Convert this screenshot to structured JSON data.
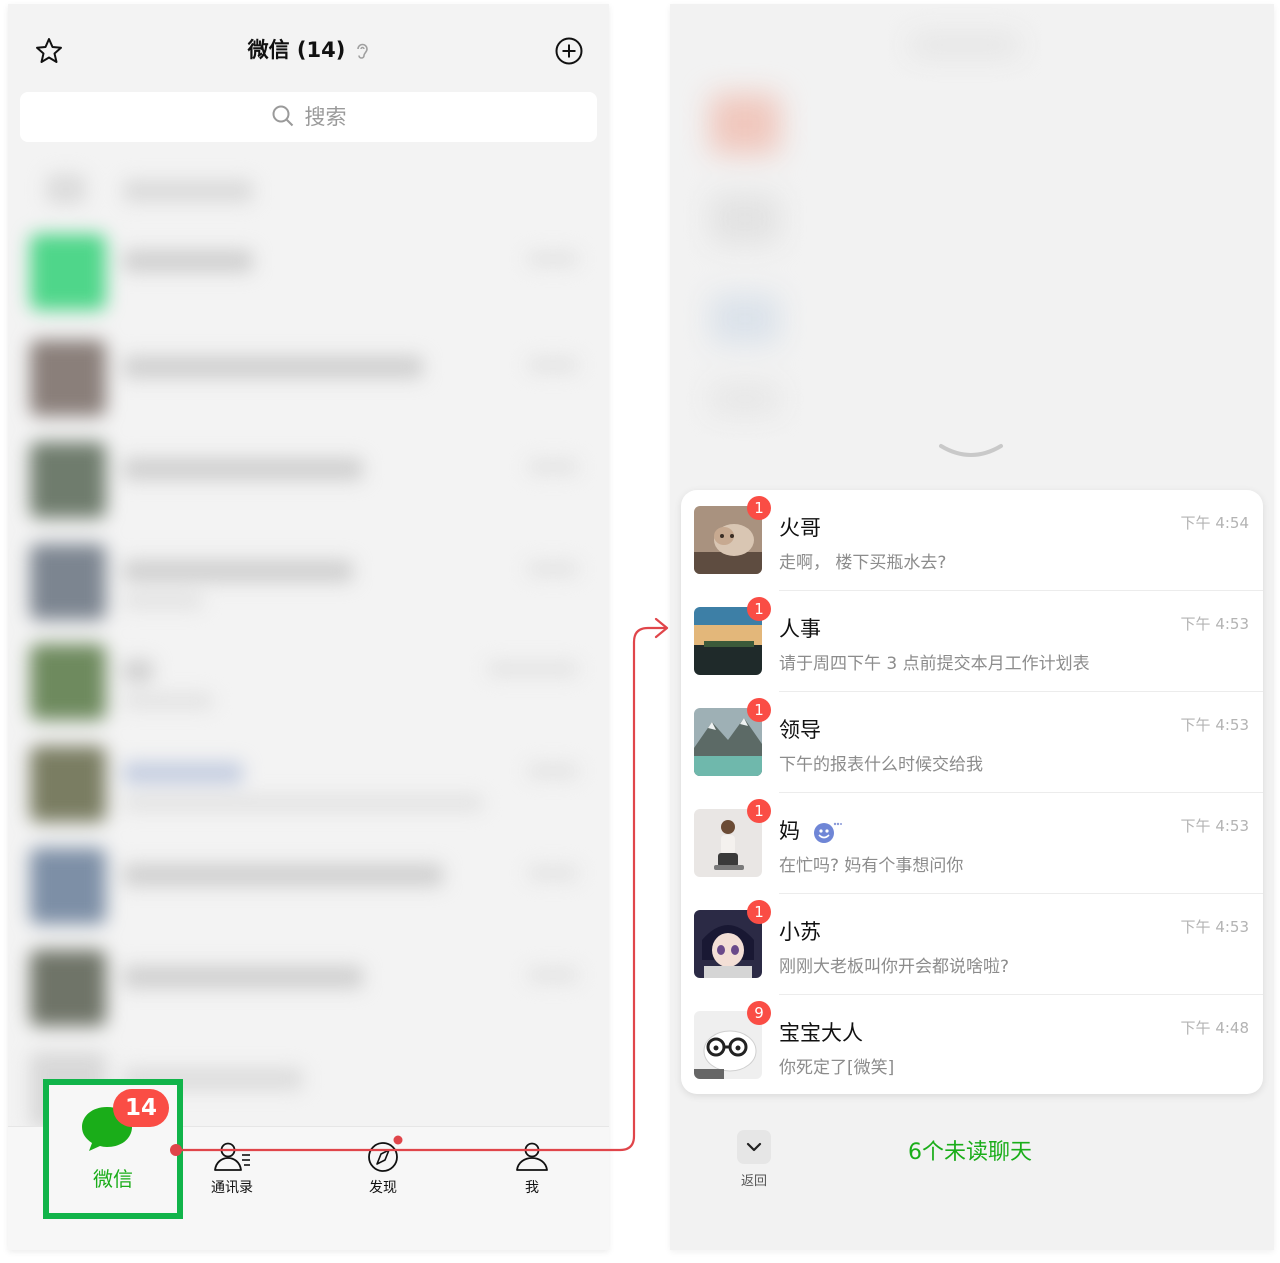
{
  "left": {
    "header": {
      "title": "微信 (14)"
    },
    "search": {
      "placeholder": "搜索"
    },
    "tabs": [
      {
        "label": "微信",
        "badge": "14"
      },
      {
        "label": "通讯录"
      },
      {
        "label": "发现"
      },
      {
        "label": "我"
      }
    ]
  },
  "right": {
    "chats": [
      {
        "name": "火哥",
        "message": "走啊，  楼下买瓶水去?",
        "time": "下午 4:54",
        "badge": "1"
      },
      {
        "name": "人事",
        "message": "请于周四下午 3 点前提交本月工作计划表",
        "time": "下午 4:53",
        "badge": "1"
      },
      {
        "name": "领导",
        "message": "下午的报表什么时候交给我",
        "time": "下午 4:53",
        "badge": "1"
      },
      {
        "name": "妈",
        "message": "在忙吗? 妈有个事想问你",
        "time": "下午 4:53",
        "badge": "1"
      },
      {
        "name": "小苏",
        "message": "刚刚大老板叫你开会都说啥啦?",
        "time": "下午 4:53",
        "badge": "1"
      },
      {
        "name": "宝宝大人",
        "message": "你死定了[微笑]",
        "time": "下午 4:48",
        "badge": "9"
      }
    ],
    "footer": {
      "back_label": "返回",
      "unread_label": "6个未读聊天"
    }
  },
  "colors": {
    "accent": "#1aad19",
    "badge": "#fa4d45",
    "highlight": "#11b44a",
    "connector": "#e0454a"
  }
}
